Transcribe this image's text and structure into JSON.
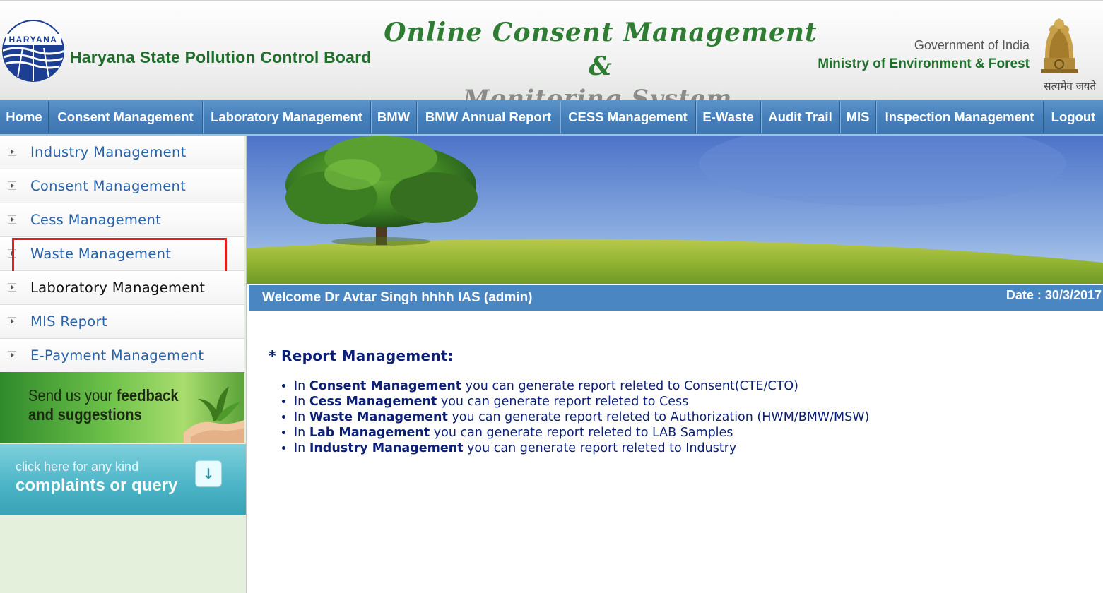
{
  "header": {
    "logo_text": "HARYANA",
    "board_name": "Haryana State Pollution Control Board",
    "system_title_line1": "Online Consent Management &",
    "system_title_line2": "Monitoring System",
    "gov_line1": "Government of India",
    "gov_line2": "Ministry of Environment & Forest",
    "motto": "सत्यमेव जयते"
  },
  "nav": {
    "items": [
      {
        "label": "Home"
      },
      {
        "label": "Consent Management"
      },
      {
        "label": "Laboratory Management"
      },
      {
        "label": "BMW"
      },
      {
        "label": "BMW Annual Report"
      },
      {
        "label": "CESS Management"
      },
      {
        "label": "E-Waste"
      },
      {
        "label": "Audit Trail"
      },
      {
        "label": "MIS"
      },
      {
        "label": "Inspection Management"
      },
      {
        "label": "Logout"
      }
    ]
  },
  "sidebar": {
    "items": [
      {
        "label": "Industry Management"
      },
      {
        "label": "Consent Management"
      },
      {
        "label": "Cess Management"
      },
      {
        "label": "Waste Management"
      },
      {
        "label": "Laboratory Management"
      },
      {
        "label": "MIS Report"
      },
      {
        "label": "E-Payment Management"
      }
    ],
    "feedback_line1_normal": "Send us your ",
    "feedback_line1_bold": "feedback",
    "feedback_line2": "and suggestions",
    "complaint_line1": "click here for any kind",
    "complaint_line2": "complaints or query",
    "complaint_icon": "↓"
  },
  "welcome": {
    "text": "Welcome Dr Avtar Singh hhhh IAS (admin)",
    "date": "Date : 30/3/2017"
  },
  "report": {
    "title": "* Report Management:",
    "items": [
      {
        "prefix": "In ",
        "bold": "Consent Management",
        "rest": " you can generate report releted to Consent(CTE/CTO)"
      },
      {
        "prefix": "In ",
        "bold": "Cess Management",
        "rest": " you can generate report releted to Cess"
      },
      {
        "prefix": "In ",
        "bold": "Waste Management",
        "rest": " you can generate report releted to Authorization (HWM/BMW/MSW)"
      },
      {
        "prefix": "In ",
        "bold": "Lab Management",
        "rest": " you can generate report releted to LAB Samples"
      },
      {
        "prefix": "In ",
        "bold": "Industry Management",
        "rest": " you can generate report releted to Industry"
      }
    ]
  },
  "colors": {
    "nav_bg": "#4680bb",
    "sidebar_link": "#2a63a8",
    "highlight_box": "#e21f1f",
    "report_text": "#0b1f74",
    "welcome_bar": "#4a87c2"
  }
}
